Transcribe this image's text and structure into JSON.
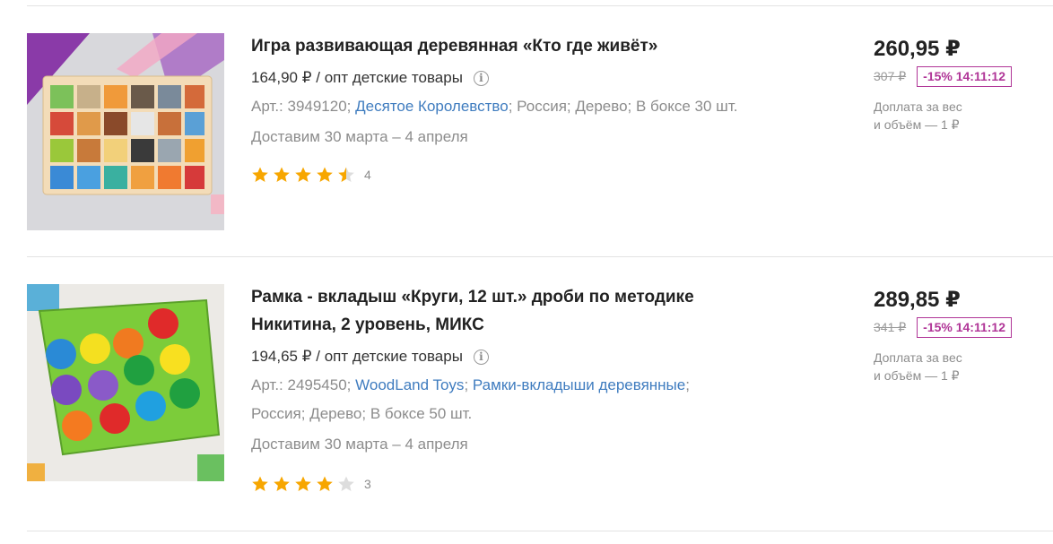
{
  "products": [
    {
      "title": "Игра развивающая деревянная «Кто где живёт»",
      "wholesale_price": "164,90 ₽ / опт детские товары",
      "meta": {
        "article": "Арт.: 3949120;",
        "brand": "Десятое Королевство",
        "rest": "; Россия; Дерево; В боксе 30 шт."
      },
      "delivery": "Доставим 30 марта – 4 апреля",
      "rating": 4.5,
      "rating_count": "4",
      "price": "260,95 ₽",
      "old_price": "307 ₽",
      "discount": "-15% 14:11:12",
      "surcharge_line1": "Доплата за вес",
      "surcharge_line2": "и объём — 1 ₽"
    },
    {
      "title_line1": "Рамка - вкладыш «Круги, 12 шт.» дроби по методике",
      "title_line2": "Никитина, 2 уровень, МИКС",
      "wholesale_price": "194,65 ₽ / опт детские товары",
      "meta": {
        "article": "Арт.: 2495450;",
        "brand": "WoodLand Toys",
        "sep": ";",
        "category": "Рамки-вкладыши деревянные",
        "tail": ";",
        "line2": "Россия; Дерево; В боксе 50 шт."
      },
      "delivery": "Доставим 30 марта – 4 апреля",
      "rating": 4,
      "rating_count": "3",
      "price": "289,85 ₽",
      "old_price": "341 ₽",
      "discount": "-15% 14:11:12",
      "surcharge_line1": "Доплата за вес",
      "surcharge_line2": "и объём — 1 ₽"
    }
  ],
  "colors": {
    "link": "#3f7cbf",
    "discount": "#b03597",
    "star": "#f7a600",
    "star_empty": "#dddddd"
  },
  "icons": [
    "info-icon",
    "star-icon"
  ]
}
